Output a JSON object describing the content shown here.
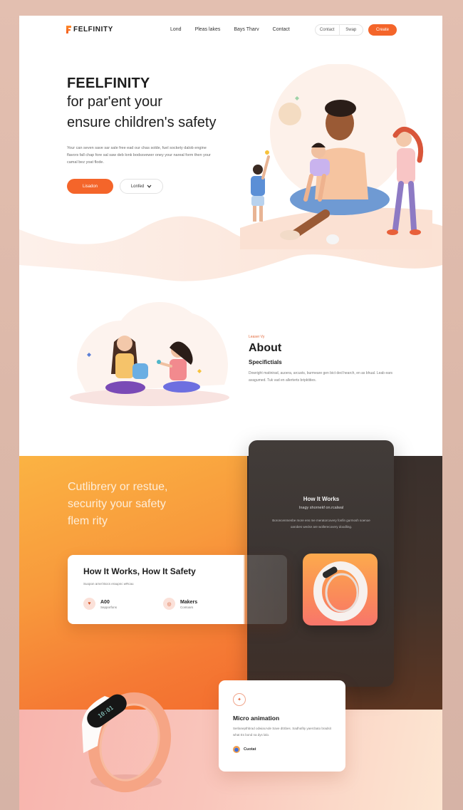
{
  "nav": {
    "brand": "FELFINITY",
    "links": [
      "Lond",
      "Pleas lakes",
      "Bays Tharv",
      "Contact"
    ],
    "pill": [
      "Contact",
      "Swap"
    ],
    "cta": "Create"
  },
  "hero": {
    "title": "FEELFINITY",
    "subtitle_line1": "for par'ent your",
    "subtitle_line2": "ensure children's safety",
    "body": "Your can seven save sar sale free ead our chas solde, fuel sockety dalob engine flavors fall chap fore sal saw deb lonk bodssvewer oney your nareal form then your camal bez yoat flode.",
    "primary_button": "Lisadon",
    "secondary_button": "Lonfed",
    "secondary_chevron": "chevron-down-icon"
  },
  "about": {
    "kicker": "Leaser Vy",
    "title": "About",
    "subtitle": "Specifictials",
    "body": "Dowright matinirad, auoera, arcusts, burmeare gen bict ded hearch, en as bhual. Leab ears avagumed. Tuk vad en allerterts bripktities."
  },
  "feature": {
    "headline_lines": [
      "Cutlibrery or restue,",
      "security your safety",
      "flem rity"
    ],
    "dark_card": {
      "title": "How It Works",
      "subtitle": "Inagy shornekf on.rcalwal",
      "body": "Boroncenmenbe more ens me meratorcovery fonfin gurmosh soenoe oarobes wecke are wollerecovery doodling."
    },
    "works_card": {
      "title": "How It Works, How It Safety",
      "subtitle": "Suopon arnel Bocs eraupnc wRcau",
      "stats": [
        {
          "value": "A00",
          "label": "Sepporfons",
          "icon": "heart-hand-icon"
        },
        {
          "value": "Makers",
          "label": "Contoars",
          "icon": "ring-icon"
        }
      ]
    },
    "micro_card": {
      "title": "Micro animation",
      "body": "Serlanepthbrad odwiacAde Save dtSbes. Sadhafity yaercbato bradsit what Es bond na dys lalo.",
      "link": "Cuotat"
    },
    "band_display": "10:01"
  },
  "colors": {
    "accent": "#f4652a",
    "dark_card": "#3b3431",
    "page_bg": "#e3bfb0"
  }
}
